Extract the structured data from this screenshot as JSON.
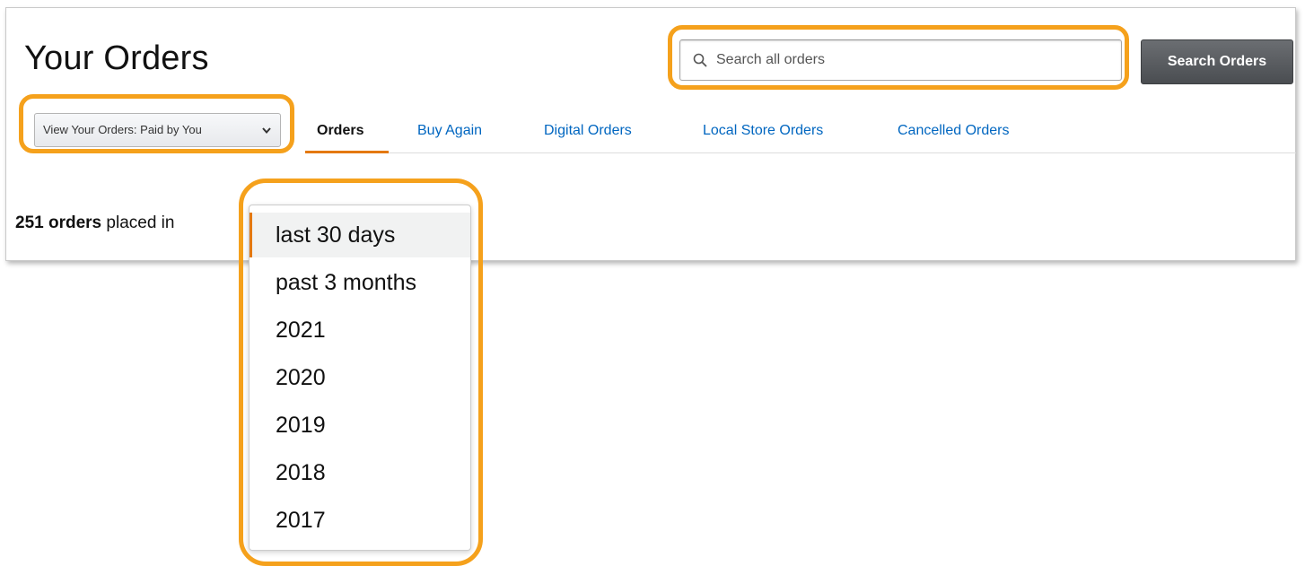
{
  "header": {
    "title": "Your Orders"
  },
  "search": {
    "placeholder": "Search all orders",
    "button_label": "Search Orders"
  },
  "filter": {
    "selected_label": "View Your Orders: Paid by You"
  },
  "tabs": [
    {
      "label": "Orders",
      "active": true
    },
    {
      "label": "Buy Again",
      "active": false
    },
    {
      "label": "Digital Orders",
      "active": false
    },
    {
      "label": "Local Store Orders",
      "active": false
    },
    {
      "label": "Cancelled Orders",
      "active": false
    }
  ],
  "orders_summary": {
    "count_label": "251 orders",
    "suffix": "placed in"
  },
  "period_dropdown": {
    "options": [
      "last 30 days",
      "past 3 months",
      "2021",
      "2020",
      "2019",
      "2018",
      "2017"
    ],
    "selected": "last 30 days"
  },
  "colors": {
    "highlight": "#f5a11c",
    "link": "#0066c0",
    "active_tab_underline": "#e47911",
    "search_button": "#4a4d51"
  },
  "icons": {
    "search": "search-icon",
    "chevron": "chevron-down-icon"
  }
}
